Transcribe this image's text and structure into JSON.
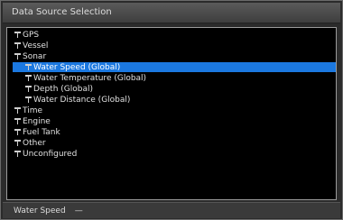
{
  "title": "Data Source Selection",
  "tree": {
    "gps": "GPS",
    "vessel": "Vessel",
    "sonar": "Sonar",
    "water_speed": "Water Speed (Global)",
    "water_temperature": "Water Temperature (Global)",
    "depth": "Depth (Global)",
    "water_distance": "Water Distance (Global)",
    "time": "Time",
    "engine": "Engine",
    "fuel_tank": "Fuel Tank",
    "other": "Other",
    "unconfigured": "Unconfigured"
  },
  "footer": {
    "label": "Water Speed",
    "value": "—"
  },
  "colors": {
    "selection": "#1b78e0",
    "background": "#000000"
  }
}
